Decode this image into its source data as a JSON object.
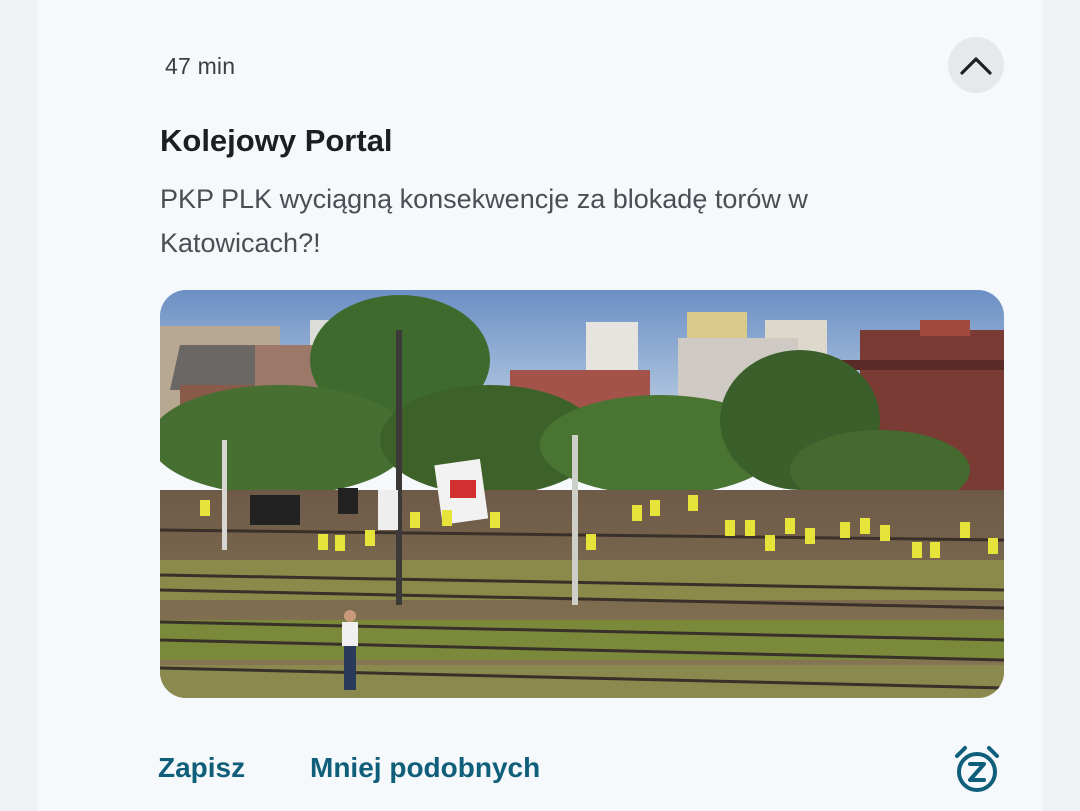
{
  "card": {
    "time_ago": "47 min",
    "source": "Kolejowy Portal",
    "headline": "PKP PLK wyciągną konsekwencje za blokadę torów w Katowicach?!",
    "collapse_icon": "chevron-up-icon",
    "image_icon": "news-photo",
    "actions": {
      "save_label": "Zapisz",
      "less_similar_label": "Mniej podobnych",
      "snooze_icon": "alarm-clock-z-icon"
    }
  },
  "colors": {
    "accent": "#0f5f7a",
    "card_background": "#f6f9fb",
    "page_background": "#eef2f5"
  }
}
